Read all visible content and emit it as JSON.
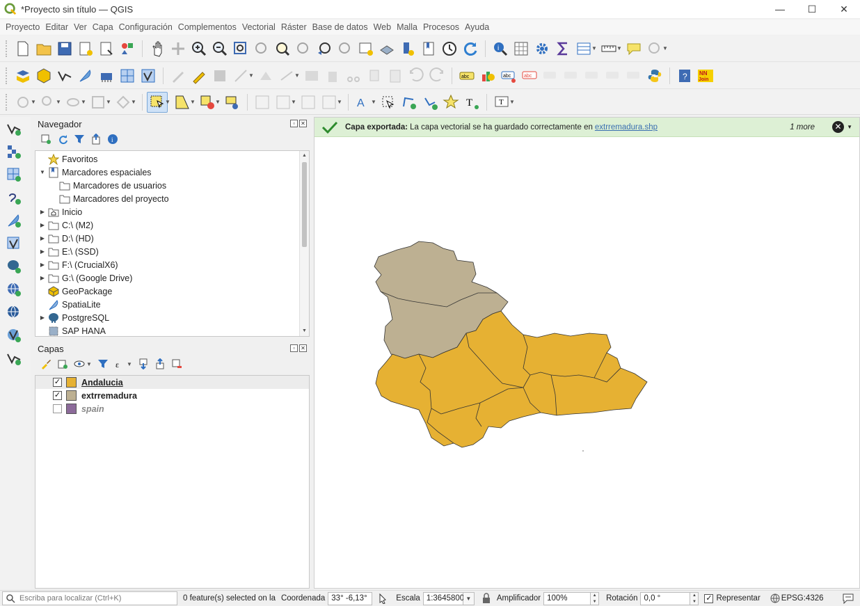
{
  "window": {
    "title": "*Proyecto sin título — QGIS",
    "minimize": "—",
    "maximize": "☐",
    "close": "✕"
  },
  "menu": [
    "Proyecto",
    "Editar",
    "Ver",
    "Capa",
    "Configuración",
    "Complementos",
    "Vectorial",
    "Ráster",
    "Base de datos",
    "Web",
    "Malla",
    "Procesos",
    "Ayuda"
  ],
  "navigator": {
    "title": "Navegador",
    "items": [
      {
        "label": "Favoritos",
        "icon": "star-icon",
        "expander": ""
      },
      {
        "label": "Marcadores espaciales",
        "icon": "bookmark-icon",
        "expander": "▼"
      },
      {
        "label": "Marcadores de usuarios",
        "icon": "folder-icon",
        "expander": ""
      },
      {
        "label": "Marcadores del proyecto",
        "icon": "folder-icon",
        "expander": ""
      },
      {
        "label": "Inicio",
        "icon": "home-folder-icon",
        "expander": "▶"
      },
      {
        "label": "C:\\ (M2)",
        "icon": "folder-icon",
        "expander": "▶"
      },
      {
        "label": "D:\\ (HD)",
        "icon": "folder-icon",
        "expander": "▶"
      },
      {
        "label": "E:\\ (SSD)",
        "icon": "folder-icon",
        "expander": "▶"
      },
      {
        "label": "F:\\ (CrucialX6)",
        "icon": "folder-icon",
        "expander": "▶"
      },
      {
        "label": "G:\\ (Google Drive)",
        "icon": "folder-icon",
        "expander": "▶"
      },
      {
        "label": "GeoPackage",
        "icon": "geopackage-icon",
        "expander": ""
      },
      {
        "label": "SpatiaLite",
        "icon": "spatialite-icon",
        "expander": ""
      },
      {
        "label": "PostgreSQL",
        "icon": "postgresql-icon",
        "expander": "▶"
      },
      {
        "label": "SAP HANA",
        "icon": "sap-hana-icon",
        "expander": ""
      }
    ]
  },
  "layers": {
    "title": "Capas",
    "items": [
      {
        "name": "Andalucia",
        "checked": "✓",
        "color": "#e6b133"
      },
      {
        "name": "extrremadura",
        "checked": "✓",
        "color": "#bdb092"
      },
      {
        "name": "spain",
        "checked": "",
        "color": "#8c6b9a"
      }
    ]
  },
  "message": {
    "bold": "Capa exportada:",
    "text": "La capa vectorial se ha guardado correctamente en",
    "link": "extrremadura.shp",
    "more": "1 more",
    "close_glyph": "✕"
  },
  "status": {
    "locator_placeholder": "Escriba para localizar (Ctrl+K)",
    "selected": "0 feature(s) selected on la",
    "coord_label": "Coordenada",
    "coord_value": "33° -6,13°",
    "scale_label": "Escala",
    "scale_value": "1:3645800",
    "magnifier_label": "Amplificador",
    "magnifier_value": "100%",
    "rotation_label": "Rotación",
    "rotation_value": "0,0 °",
    "render_check": "✓",
    "render_label": "Representar",
    "crs": "EPSG:4326"
  },
  "colors": {
    "andalucia": "#e6b133",
    "extremadura": "#bdb092",
    "spain": "#8c6b9a",
    "message_bg": "#ddf0d5"
  }
}
